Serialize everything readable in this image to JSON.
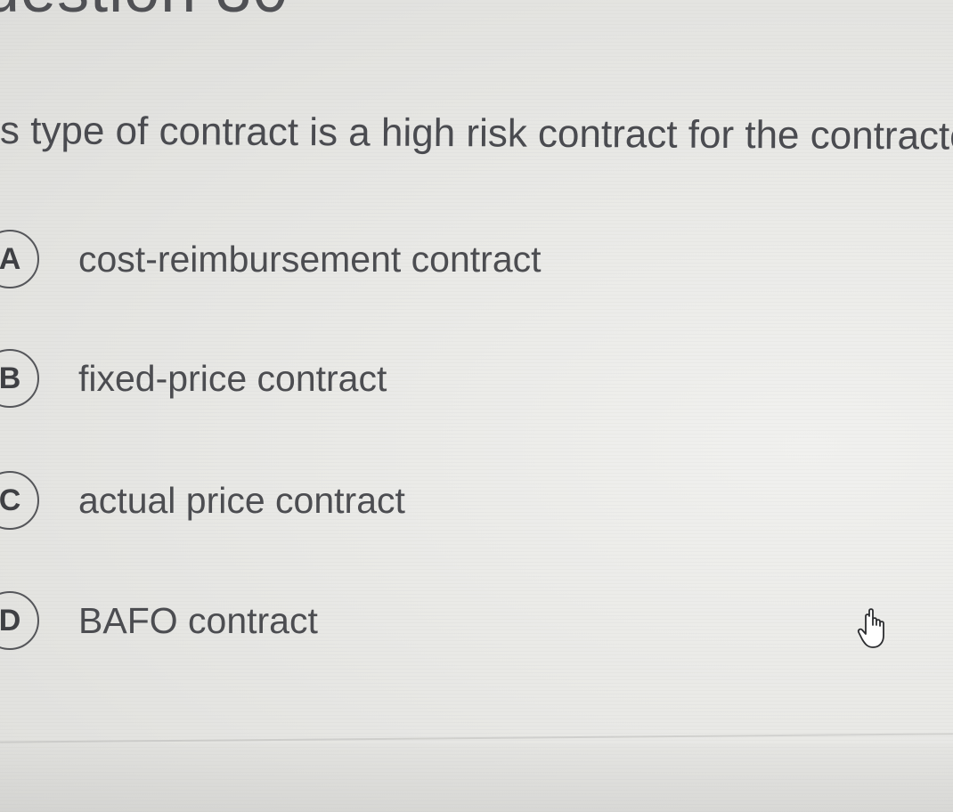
{
  "header": {
    "title": "uestion 30"
  },
  "question": {
    "text": "s type of contract is a high risk contract for the contractor."
  },
  "options": [
    {
      "letter": "A",
      "label": "cost-reimbursement contract"
    },
    {
      "letter": "B",
      "label": "fixed-price contract"
    },
    {
      "letter": "C",
      "label": "actual price contract"
    },
    {
      "letter": "D",
      "label": "BAFO contract"
    }
  ],
  "cursor": {
    "icon": "hand-pointer-icon"
  },
  "colors": {
    "text": "#4a4b50",
    "circle_border": "#55565a",
    "background": "#e9e9e6"
  }
}
